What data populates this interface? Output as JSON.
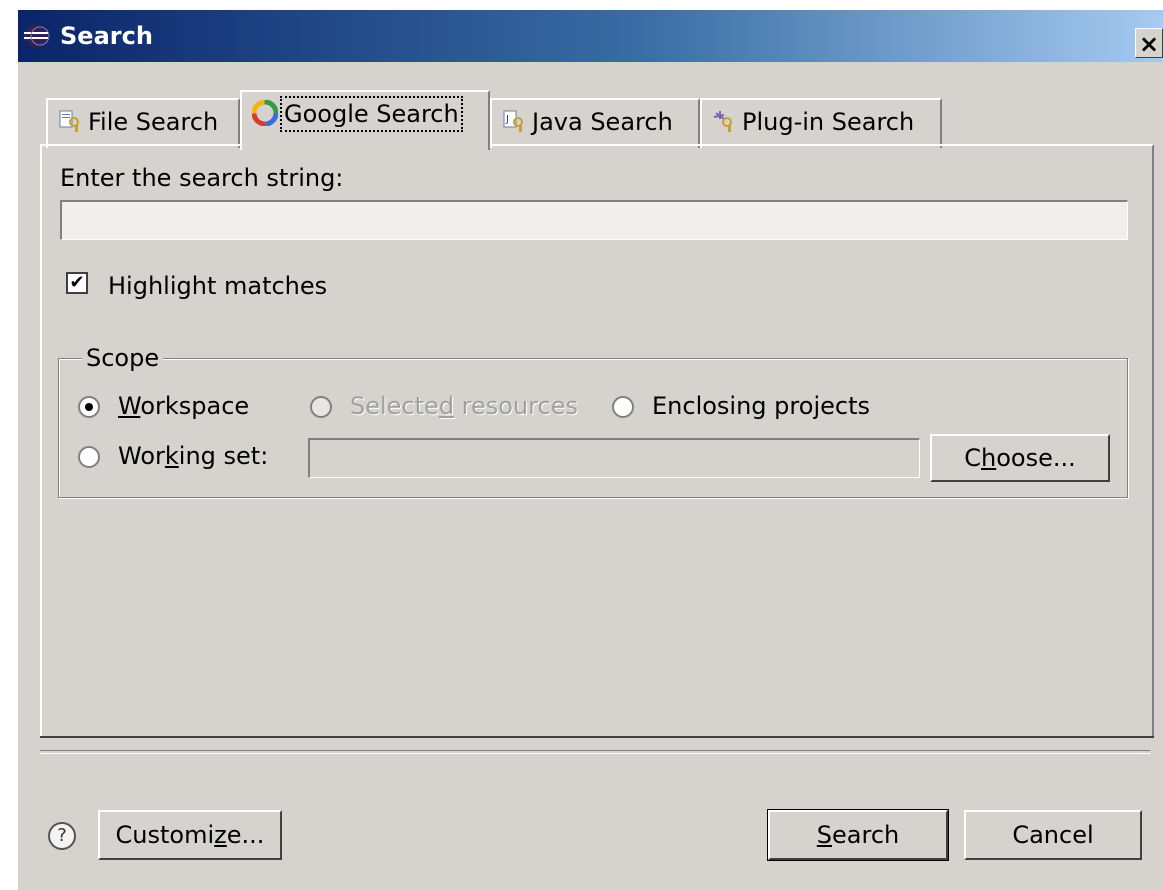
{
  "window": {
    "title": "Search",
    "close_glyph": "×"
  },
  "tabs": [
    {
      "label": "File Search",
      "icon": "file-search-icon"
    },
    {
      "label": "Google Search",
      "icon": "google-search-icon",
      "active": true
    },
    {
      "label": "Java Search",
      "icon": "java-search-icon"
    },
    {
      "label": "Plug-in Search",
      "icon": "plugin-search-icon"
    }
  ],
  "search": {
    "label": "Enter the search string:",
    "value": "",
    "highlight_label": "Highlight matches",
    "highlight_checked": true,
    "check_glyph": "✔"
  },
  "scope": {
    "legend": "Scope",
    "workspace": {
      "pre": "",
      "mnemonic": "W",
      "post": "orkspace",
      "selected": true
    },
    "selected_resources": {
      "pre": "Selecte",
      "mnemonic": "d",
      "post": " resources",
      "enabled": false
    },
    "enclosing_projects": {
      "pre": "Enclosing pro",
      "mnemonic": "j",
      "post": "ects"
    },
    "working_set": {
      "pre": "Wor",
      "mnemonic": "k",
      "post": "ing set:",
      "value": ""
    },
    "choose": {
      "pre": "C",
      "mnemonic": "h",
      "post": "oose..."
    }
  },
  "footer": {
    "help_glyph": "?",
    "customize": {
      "pre": "Customi",
      "mnemonic": "z",
      "post": "e..."
    },
    "search": {
      "pre": "",
      "mnemonic": "S",
      "post": "earch"
    },
    "cancel": "Cancel"
  }
}
